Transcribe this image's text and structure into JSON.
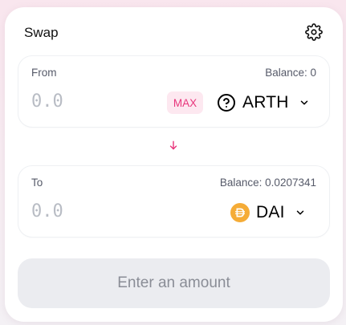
{
  "swap": {
    "title": "Swap",
    "from": {
      "label": "From",
      "balance": "Balance: 0",
      "amount_placeholder": "0.0",
      "max_label": "MAX",
      "token": "ARTH",
      "token_icon": "question-circle-icon"
    },
    "to": {
      "label": "To",
      "balance": "Balance: 0.0207341",
      "amount_placeholder": "0.0",
      "token": "DAI",
      "token_icon": "dai-coin-icon"
    },
    "submit_label": "Enter an amount"
  },
  "colors": {
    "accent": "#e8357b",
    "dai": "#f5ac37",
    "disabled_button_bg": "#ebecf0"
  }
}
